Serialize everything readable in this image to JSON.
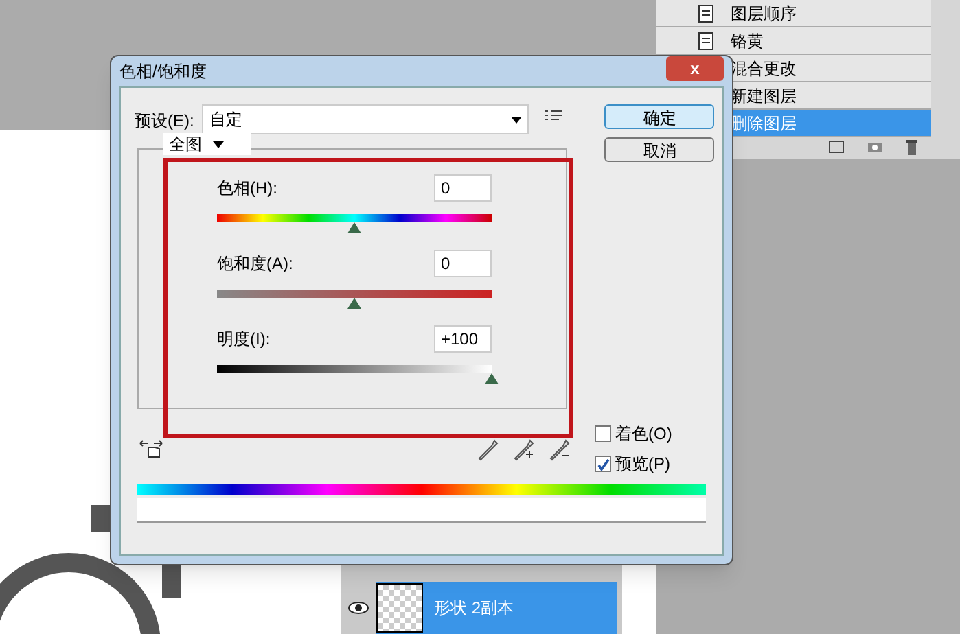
{
  "history_panel": {
    "items": [
      {
        "label": "图层顺序",
        "selected": false
      },
      {
        "label": "铬黄",
        "selected": false
      },
      {
        "label": "混合更改",
        "selected": false
      },
      {
        "label": "新建图层",
        "selected": false
      },
      {
        "label": "删除图层",
        "selected": true
      }
    ]
  },
  "dialog": {
    "title": "色相/饱和度",
    "close": "x",
    "preset": {
      "label": "预设(E):",
      "value": "自定"
    },
    "buttons": [
      "确定",
      "取消"
    ],
    "channel": "全图",
    "sliders": [
      {
        "label": "色相(H):",
        "value": "0",
        "level": 0.5,
        "kind": "hue"
      },
      {
        "label": "饱和度(A):",
        "value": "0",
        "level": 0.5,
        "kind": "saturation"
      },
      {
        "label": "明度(I):",
        "value": "+100",
        "level": 1,
        "kind": "lightness"
      }
    ],
    "options": [
      {
        "label": "着色(O)",
        "checked": false
      },
      {
        "label": "预览(P)",
        "checked": true
      }
    ]
  },
  "layers_panel": {
    "layer": {
      "name": "形状 2副本",
      "selected": true
    }
  }
}
